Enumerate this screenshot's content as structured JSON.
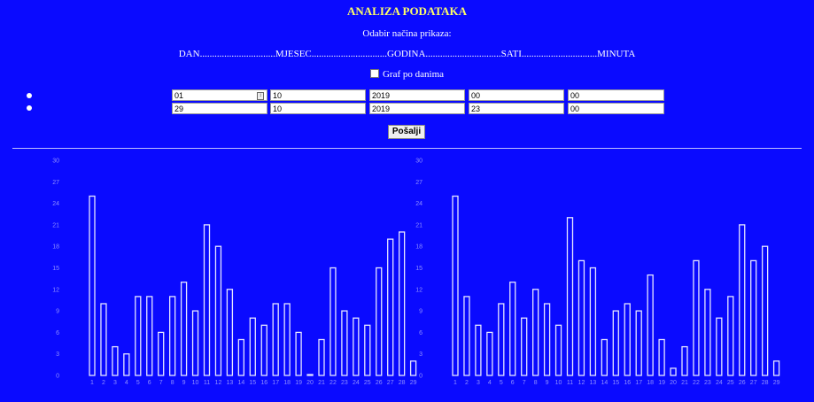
{
  "page": {
    "title": "ANALIZA PODATAKA",
    "subtitle": "Odabir načina prikaza:",
    "modes": [
      "DAN",
      "MJESEC",
      "GODINA",
      "SATI",
      "MINUTA"
    ],
    "separator": "...............................",
    "checkbox_label": "Graf po danima",
    "checkbox_checked": false,
    "send_button": "Pošalji"
  },
  "form": {
    "row1": {
      "dan": "01",
      "mjesec": "10",
      "godina": "2019",
      "sati": "00",
      "minuta": "00"
    },
    "row2": {
      "dan": "29",
      "mjesec": "10",
      "godina": "2019",
      "sati": "23",
      "minuta": "00"
    }
  },
  "colors": {
    "background": "#0a0aff",
    "title": "#ffff66",
    "bar_stroke": "#e6e6ff",
    "axis_text": "#8f8fff"
  },
  "chart_data": [
    {
      "type": "bar",
      "categories": [
        "1",
        "2",
        "3",
        "4",
        "5",
        "6",
        "7",
        "8",
        "9",
        "10",
        "11",
        "12",
        "13",
        "14",
        "15",
        "16",
        "17",
        "18",
        "19",
        "20",
        "21",
        "22",
        "23",
        "24",
        "25",
        "26",
        "27",
        "28",
        "29"
      ],
      "values": [
        25,
        10,
        4,
        3,
        11,
        11,
        6,
        11,
        13,
        9,
        21,
        18,
        12,
        5,
        8,
        7,
        10,
        10,
        6,
        0,
        5,
        15,
        9,
        8,
        7,
        15,
        19,
        20,
        2
      ],
      "ylim": [
        0,
        30
      ],
      "yticks": [
        0,
        3,
        6,
        9,
        12,
        15,
        18,
        21,
        24,
        27,
        30
      ],
      "grid": false
    },
    {
      "type": "bar",
      "categories": [
        "1",
        "2",
        "3",
        "4",
        "5",
        "6",
        "7",
        "8",
        "9",
        "10",
        "11",
        "12",
        "13",
        "14",
        "15",
        "16",
        "17",
        "18",
        "19",
        "20",
        "21",
        "22",
        "23",
        "24",
        "25",
        "26",
        "27",
        "28",
        "29"
      ],
      "values": [
        25,
        11,
        7,
        6,
        10,
        13,
        8,
        12,
        10,
        7,
        22,
        16,
        15,
        5,
        9,
        10,
        9,
        14,
        5,
        1,
        4,
        16,
        12,
        8,
        11,
        21,
        16,
        18,
        2
      ],
      "ylim": [
        0,
        30
      ],
      "yticks": [
        0,
        3,
        6,
        9,
        12,
        15,
        18,
        21,
        24,
        27,
        30
      ],
      "grid": false
    }
  ]
}
